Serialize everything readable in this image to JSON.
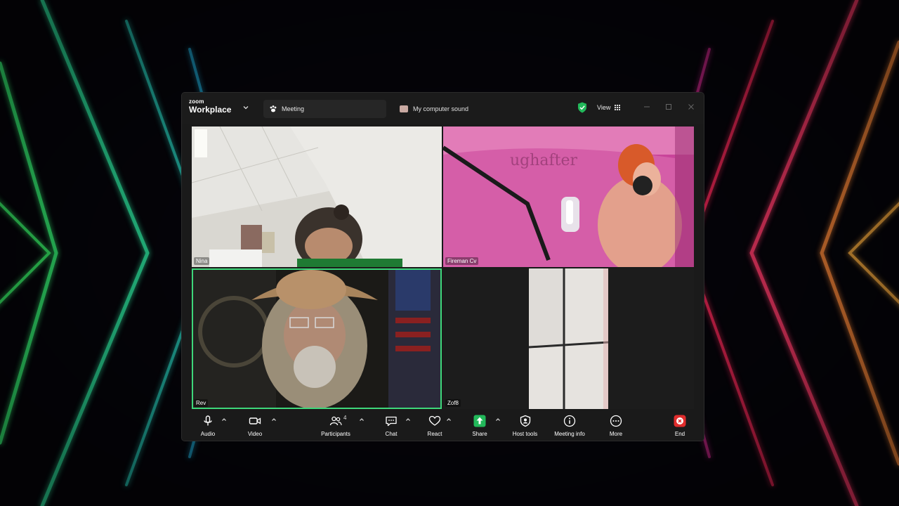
{
  "window": {
    "brand_small": "zoom",
    "brand_name": "Workplace",
    "meeting_tab": "Meeting",
    "sound_tab": "My computer sound",
    "view_label": "View"
  },
  "participants": [
    {
      "name": "Nina"
    },
    {
      "name": "Fireman Cv"
    },
    {
      "name": "Rev"
    },
    {
      "name": "Zof8"
    }
  ],
  "toolbar": {
    "audio": "Audio",
    "video": "Video",
    "participants": "Participants",
    "participant_count": "4",
    "chat": "Chat",
    "react": "React",
    "share": "Share",
    "host_tools": "Host tools",
    "meeting_info": "Meeting info",
    "more": "More",
    "end": "End"
  },
  "colors": {
    "speaking_border": "#3ed77a",
    "share_green": "#22b85a",
    "end_red": "#e02c2c",
    "secure_green": "#22b85a"
  },
  "icons": {
    "secure": "shield-check-icon",
    "audio": "microphone-icon",
    "video": "camera-icon",
    "participants": "people-icon",
    "chat": "chat-bubble-icon",
    "react": "heart-icon",
    "share": "share-up-arrow-icon",
    "host_tools": "shield-icon",
    "meeting_info": "info-icon",
    "more": "ellipsis-icon",
    "end": "close-icon"
  }
}
